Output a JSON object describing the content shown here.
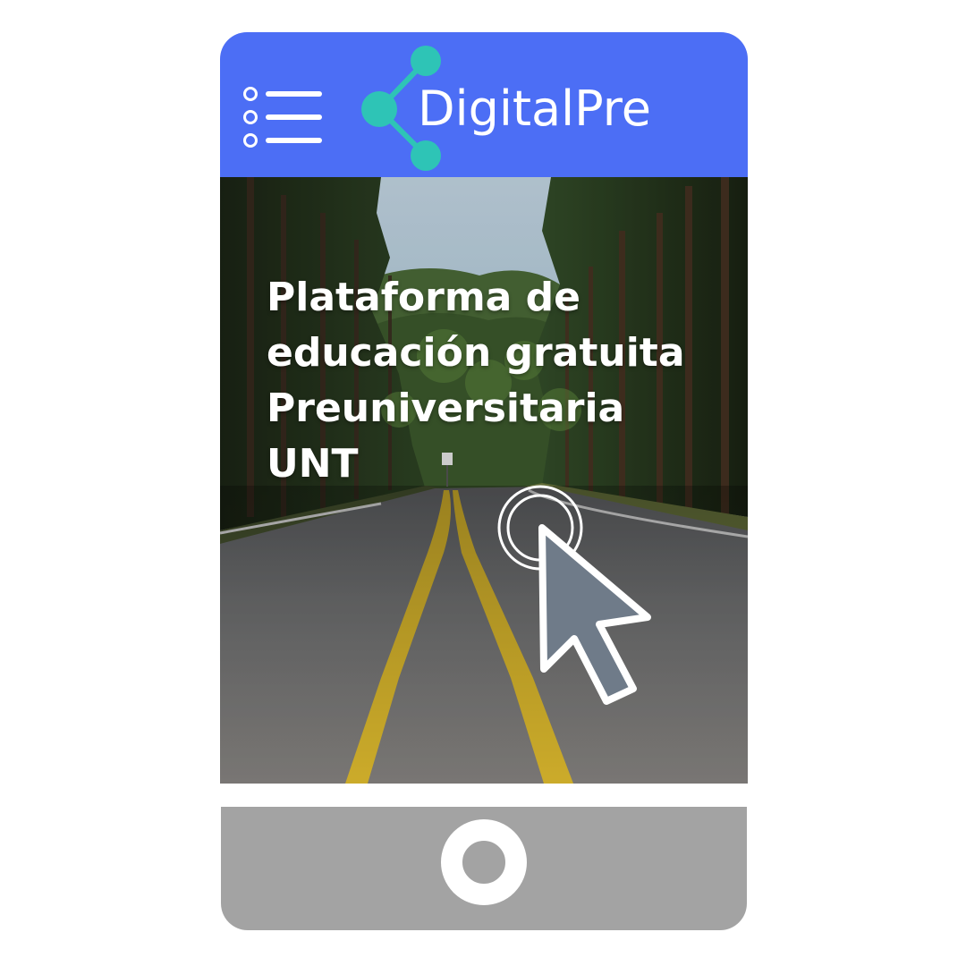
{
  "app": {
    "brand_name": "DigitalPre",
    "brand_color": "#4c6ef5",
    "logo_accent_color": "#2ec4b6"
  },
  "header": {
    "menu_icon": "list-menu-icon",
    "logo_icon": "share-nodes-icon"
  },
  "hero": {
    "title_lines": [
      "Plataforma de",
      "educación gratuita",
      "Preuniversitaria",
      "UNT"
    ],
    "background_image": "forest-road-photo"
  },
  "pointer": {
    "icon": "mouse-pointer-click-icon",
    "color": "#6f7b89"
  },
  "footer": {
    "bar_color": "#a3a3a3",
    "home_icon": "home-button-icon"
  }
}
